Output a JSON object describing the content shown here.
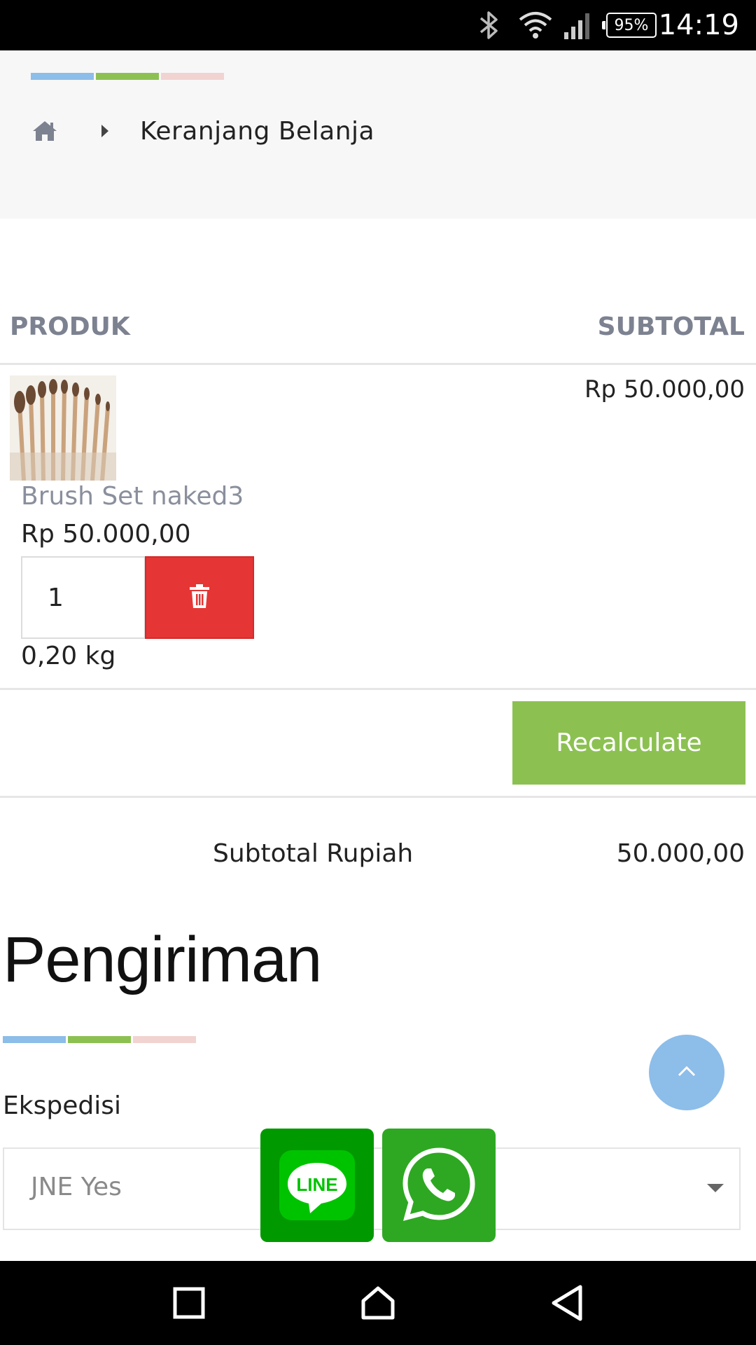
{
  "status_bar": {
    "battery": "95%",
    "time": "14:19",
    "icons": [
      "bluetooth-icon",
      "wifi-icon",
      "signal-icon",
      "battery-icon"
    ]
  },
  "breadcrumb": {
    "home_icon": "home-icon",
    "separator_icon": "caret-right-icon",
    "current": "Keranjang Belanja"
  },
  "cart": {
    "headers": {
      "product": "PRODUK",
      "subtotal": "SUBTOTAL"
    },
    "items": [
      {
        "name": "Brush Set naked3",
        "price": "Rp 50.000,00",
        "quantity": "1",
        "weight": "0,20 kg",
        "subtotal": "Rp 50.000,00",
        "delete_icon": "trash-icon"
      }
    ],
    "recalculate_label": "Recalculate",
    "summary": {
      "label": "Subtotal Rupiah",
      "value": "50.000,00"
    }
  },
  "shipping": {
    "title": "Pengiriman",
    "courier_label": "Ekspedisi",
    "courier_selected": "JNE Yes"
  },
  "floating": {
    "scroll_top_icon": "chevron-up-icon",
    "line_label": "LINE",
    "whatsapp_icon": "whatsapp-icon"
  },
  "colors": {
    "accent_blue": "#8dbde9",
    "accent_green": "#8cc152",
    "accent_pink": "#f1d3d1",
    "danger_red": "#e53535",
    "line_green": "#009a00",
    "whatsapp_green": "#2ea822"
  }
}
